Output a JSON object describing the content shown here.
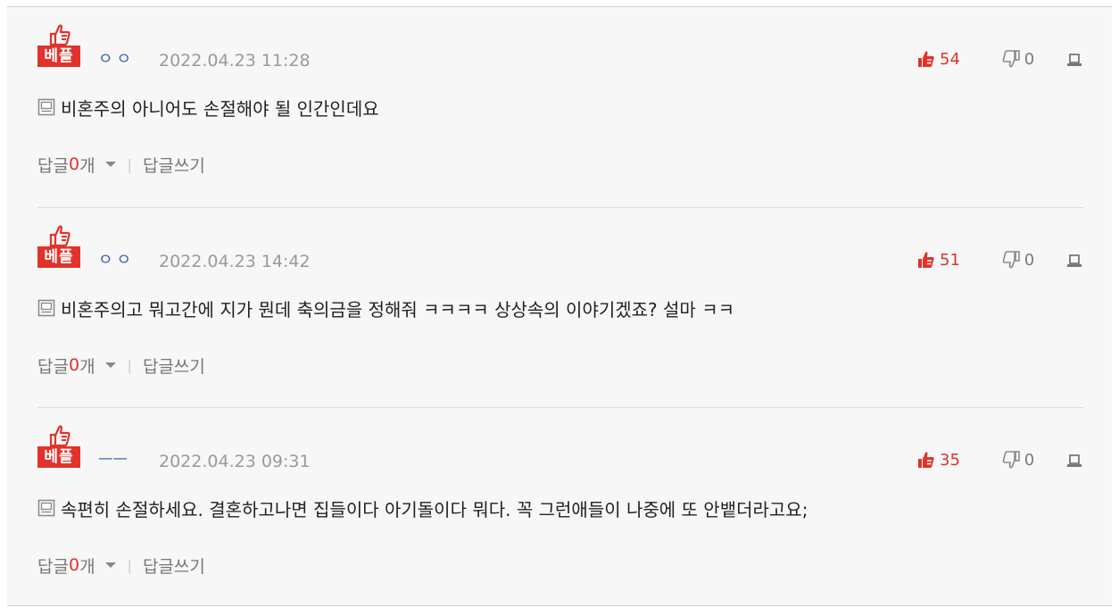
{
  "comments": [
    {
      "badge": "베플",
      "nickname": "ㅇㅇ",
      "date": "2022.04.23 11:28",
      "upvotes": "54",
      "downvotes": "0",
      "text": "비혼주의 아니어도 손절해야 될 인간인데요",
      "reply_prefix": "답글 ",
      "reply_count": "0",
      "reply_suffix": "개",
      "write_reply": "답글쓰기"
    },
    {
      "badge": "베플",
      "nickname": "ㅇㅇ",
      "date": "2022.04.23 14:42",
      "upvotes": "51",
      "downvotes": "0",
      "text": "비혼주의고 뭐고간에 지가 뭔데 축의금을 정해줘 ㅋㅋㅋㅋ 상상속의 이야기겠죠? 설마 ㅋㅋ",
      "reply_prefix": "답글 ",
      "reply_count": "0",
      "reply_suffix": "개",
      "write_reply": "답글쓰기"
    },
    {
      "badge": "베플",
      "nickname": "ㅡㅡ",
      "date": "2022.04.23 09:31",
      "upvotes": "35",
      "downvotes": "0",
      "text": "속편히 손절하세요. 결혼하고나면 집들이다 아기돌이다 뭐다. 꼭 그런애들이 나중에 또 안뱉더라고요;",
      "reply_prefix": "답글 ",
      "reply_count": "0",
      "reply_suffix": "개",
      "write_reply": "답글쓰기"
    }
  ],
  "colors": {
    "accent_red": "#e0332b",
    "nickname_blue": "#3a64a8",
    "muted_gray": "#9a9a9a",
    "panel_bg": "#f7f7f7"
  },
  "icons": {
    "badge": "thumbs-up-icon",
    "upvote": "thumbs-up-icon",
    "downvote": "thumbs-down-icon",
    "report": "report-icon",
    "body": "document-icon",
    "replies": "caret-down-icon"
  }
}
